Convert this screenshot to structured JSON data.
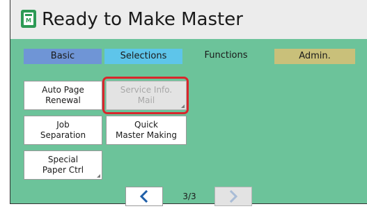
{
  "header": {
    "title": "Ready to Make Master",
    "icon": "master-document-icon",
    "icon_letter": "M"
  },
  "tabs": [
    {
      "label": "Basic",
      "color": "#6f95d6"
    },
    {
      "label": "Selections",
      "color": "#5ec5ea"
    },
    {
      "label": "Functions",
      "color": "#6cc39a",
      "active": true
    },
    {
      "label": "Admin.",
      "color": "#c9c07a"
    }
  ],
  "buttons": {
    "auto_page_renewal": "Auto Page\nRenewal",
    "service_info_mail": "Service Info.\nMail",
    "job_separation": "Job\nSeparation",
    "quick_master_making": "Quick\nMaster Making",
    "special_paper_ctrl": "Special\nPaper Ctrl"
  },
  "pagination": {
    "current": "3/3",
    "prev_icon": "chevron-left-icon",
    "next_icon": "chevron-right-icon"
  },
  "colors": {
    "panel_bg": "#6cc39a",
    "highlight": "#d9262c",
    "nav_arrow": "#1f5fa8"
  }
}
